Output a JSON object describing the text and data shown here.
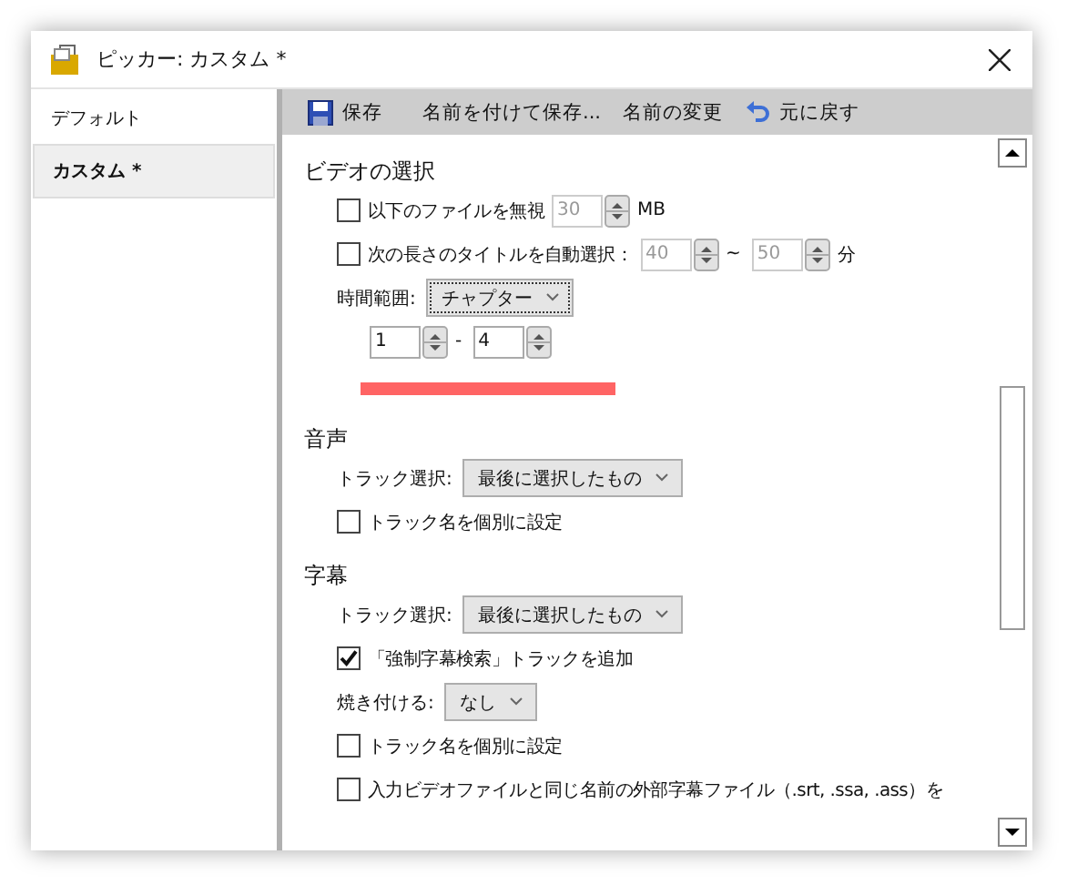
{
  "window": {
    "title": "ピッカー: カスタム *"
  },
  "sidebar": {
    "items": [
      {
        "label": "デフォルト",
        "selected": false
      },
      {
        "label": "カスタム *",
        "selected": true
      }
    ]
  },
  "toolbar": {
    "buttons": [
      {
        "label": "保存"
      },
      {
        "label": "名前を付けて保存..."
      },
      {
        "label": "名前の変更"
      },
      {
        "label": "元に戻す"
      }
    ]
  },
  "sections": [
    {
      "title": "ビデオの選択",
      "rows": [
        {
          "parts": [
            {
              "kind": "checkbox",
              "checked": false,
              "label": "以下のファイルを無視"
            },
            {
              "kind": "spin",
              "value": "30",
              "disabled": true
            },
            {
              "kind": "text",
              "text": "MB"
            }
          ]
        },
        {
          "parts": [
            {
              "kind": "checkbox",
              "checked": false,
              "label": "次の長さのタイトルを自動選択："
            },
            {
              "kind": "spin",
              "value": "40",
              "disabled": true
            },
            {
              "kind": "text",
              "text": "~"
            },
            {
              "kind": "spin",
              "value": "50",
              "disabled": true
            },
            {
              "kind": "text",
              "text": "分"
            }
          ]
        },
        {
          "parts": [
            {
              "kind": "text",
              "text": "時間範囲:"
            },
            {
              "kind": "select",
              "value": "チャプター",
              "focused": true
            }
          ]
        },
        {
          "parts": [
            {
              "kind": "spin",
              "value": "1",
              "disabled": false
            },
            {
              "kind": "text",
              "text": "-"
            },
            {
              "kind": "spin",
              "value": "4",
              "disabled": false
            }
          ]
        },
        {
          "parts": [
            {
              "kind": "highlight"
            }
          ]
        }
      ]
    },
    {
      "title": "音声",
      "rows": [
        {
          "parts": [
            {
              "kind": "text",
              "text": "トラック選択:"
            },
            {
              "kind": "select",
              "value": "最後に選択したもの",
              "focused": false
            }
          ]
        },
        {
          "parts": [
            {
              "kind": "checkbox",
              "checked": false,
              "label": "トラック名を個別に設定"
            }
          ]
        }
      ]
    },
    {
      "title": "字幕",
      "rows": [
        {
          "parts": [
            {
              "kind": "text",
              "text": "トラック選択:"
            },
            {
              "kind": "select",
              "value": "最後に選択したもの",
              "focused": false
            }
          ]
        },
        {
          "parts": [
            {
              "kind": "checkbox",
              "checked": true,
              "label": "「強制字幕検索」トラックを追加"
            }
          ]
        },
        {
          "parts": [
            {
              "kind": "text",
              "text": "焼き付ける:"
            },
            {
              "kind": "select",
              "value": "なし",
              "focused": false
            }
          ]
        },
        {
          "parts": [
            {
              "kind": "checkbox",
              "checked": false,
              "label": "トラック名を個別に設定"
            }
          ]
        },
        {
          "parts": [
            {
              "kind": "checkbox",
              "checked": false,
              "label": "入力ビデオファイルと同じ名前の外部字幕ファイル（.srt, .ssa, .ass）を"
            }
          ]
        }
      ]
    }
  ]
}
